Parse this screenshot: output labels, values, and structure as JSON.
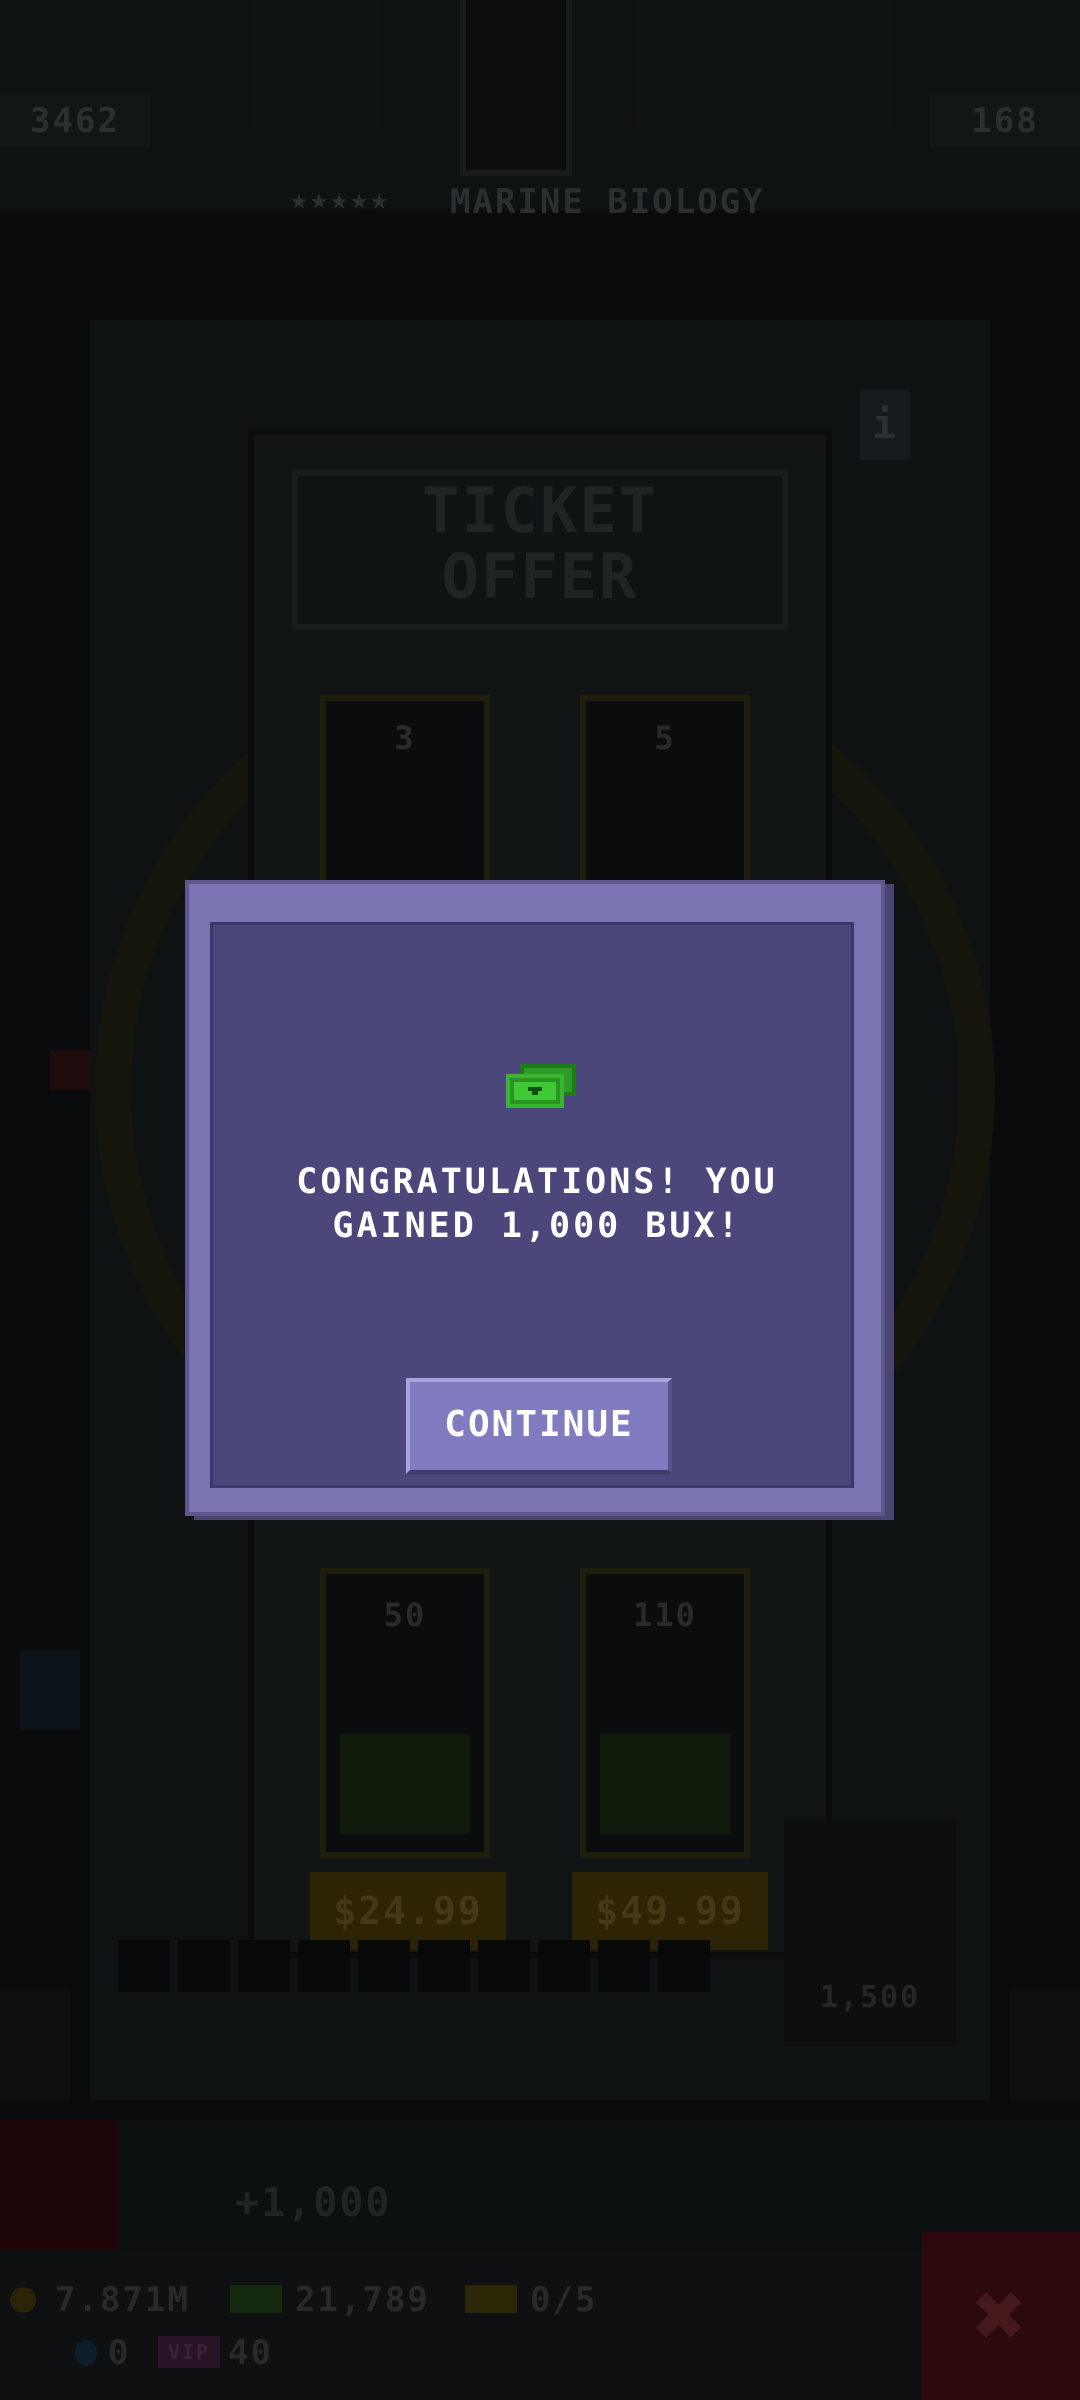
{
  "hud": {
    "top_left_value": "3462",
    "top_right_value": "168",
    "floor_rating": "★★★★★",
    "floor_name": "MARINE BIOLOGY"
  },
  "offer": {
    "title_line1": "TICKET",
    "title_line2": "OFFER",
    "packs": [
      {
        "amount": "3"
      },
      {
        "amount": "5"
      },
      {
        "amount": "50",
        "price": "$24.99"
      },
      {
        "amount": "110",
        "price": "$49.99"
      }
    ]
  },
  "side_resource": {
    "value": "1,500"
  },
  "gain_label": "+1,000",
  "bottom_stats": {
    "coins": "7.871M",
    "bux": "21,789",
    "tickets": "0/5",
    "drops": "0",
    "vip_badge": "VIP",
    "vip_value": "40"
  },
  "dialog": {
    "icon": "bux-icon",
    "message_line1": "CONGRATULATIONS! YOU",
    "message_line2": "GAINED 1,000 BUX!",
    "continue_label": "CONTINUE"
  },
  "colors": {
    "dialog_frame": "#7a74b3",
    "dialog_panel": "#4b477a",
    "button": "#817cc0",
    "bux_green": "#38b62f",
    "text": "#ffffff"
  }
}
